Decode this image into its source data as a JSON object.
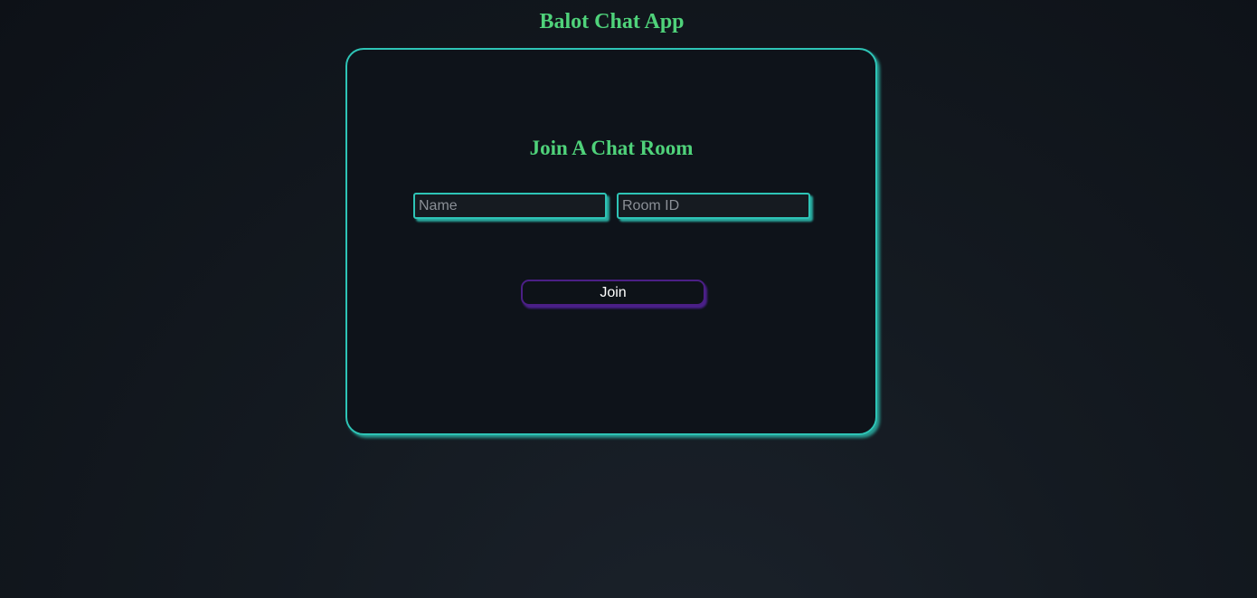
{
  "app": {
    "title": "Balot Chat App"
  },
  "join_form": {
    "heading": "Join A Chat Room",
    "name_placeholder": "Name",
    "name_value": "",
    "room_placeholder": "Room ID",
    "room_value": "",
    "join_label": "Join"
  },
  "colors": {
    "accent_green": "#4fd27a",
    "border_teal": "#2ec4b6",
    "button_purple": "#4b1f86",
    "background": "#0d1117"
  }
}
